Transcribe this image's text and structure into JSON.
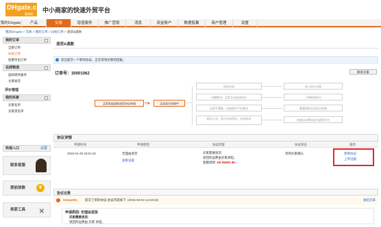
{
  "header": {
    "logo_text": "DHgate.com",
    "logo_sub": "敦煌网",
    "slogan": "中小商家的快速外贸平台"
  },
  "nav": {
    "items": [
      "我的DHgate",
      "产品",
      "交易",
      "增值服务",
      "推广营销",
      "消息",
      "资金账户",
      "数据智囊",
      "商户管理",
      "设置"
    ],
    "active_index": 2
  },
  "breadcrumb": {
    "parts": [
      "我的DHgate",
      "交易",
      "我的订单",
      "纠纷订单",
      "退货&退款"
    ],
    "sep": ">"
  },
  "sidebar": {
    "my_orders": "我的订单",
    "orders": [
      "全部订单",
      "纠纷订单",
      "批量导出订单"
    ],
    "online_logistics": "在线物流",
    "logistics_items": [
      "国际邮件服务",
      "仓库发货"
    ],
    "review_mgmt": "评价管理",
    "my_buyers": "我的买家",
    "buyer_items": [
      "买家名单",
      "买家黑名单"
    ],
    "quick_entry": "快速入口",
    "quick_set": "设置",
    "cards": [
      "联系客服",
      "提前放款",
      "卖家工具"
    ]
  },
  "main": {
    "title": "退货&退款",
    "notice": "您已提交一个新的协议，正在等待买家的回复。",
    "order_label": "订单号：",
    "order_no": "30001062",
    "contact_btn": "联系买家"
  },
  "flow": {
    "start": "买家发起退款退货协议申请",
    "negotiate": "买卖双方协商中",
    "mid": [
      "协议达成",
      "问题解决，买家主动关闭协议",
      "买家不满意，纠纷提升平台裁决",
      "超过10天，双方均未回应，关闭协议"
    ],
    "end": [
      "进入执行过程",
      "订单继续执行",
      "客服协助买卖双方处理",
      "系统自动将协议升级到平台"
    ]
  },
  "detail": {
    "title": "协议详情",
    "columns": [
      "申请时间",
      "申请原因",
      "协议内容",
      "协议状态",
      "操作"
    ],
    "row": {
      "time": "2015-01-29 15:51:42",
      "reason": "无理由退货",
      "view_proof": "查看证据",
      "content_line1": "买家需要退货:",
      "content_line2": "退回的运费由买家承担。",
      "content_line3_label": "金额退款:",
      "content_amount": "US $1647.45",
      "content_more": "»",
      "status": "等待买家确认",
      "op1": "拒绝协议",
      "op2": "上传证据"
    }
  },
  "record": {
    "title": "协议记录",
    "user": "testyu001",
    "action": "提交了新的协议,协议内容如下: (2015-03-03 14:43:18)",
    "collapse": "收起买家",
    "reason_line": "申请原因: 无理由退货",
    "sub1": "买家需要退货:",
    "sub2": "退回的运费由 买家 承担。"
  }
}
